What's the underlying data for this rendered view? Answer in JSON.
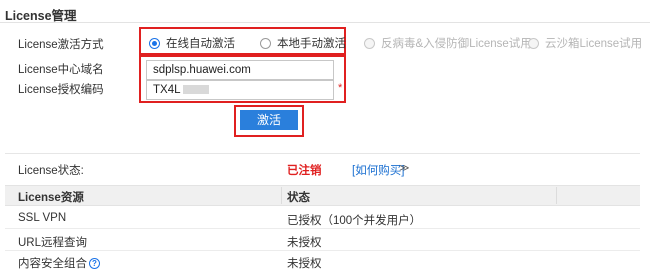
{
  "page": {
    "title": "License管理"
  },
  "form": {
    "activation_mode_label": "License激活方式",
    "modes": [
      {
        "label": "在线自动激活",
        "checked": true,
        "disabled": false
      },
      {
        "label": "本地手动激活",
        "checked": false,
        "disabled": false
      },
      {
        "label": "反病毒&入侵防御License试用",
        "checked": false,
        "disabled": true
      },
      {
        "label": "云沙箱License试用",
        "checked": false,
        "disabled": true
      }
    ],
    "domain_label": "License中心域名",
    "domain_value": "sdplsp.huawei.com",
    "code_label": "License授权编码",
    "code_value": "TX4L",
    "required_mark": "*",
    "activate_button": "激活"
  },
  "status": {
    "label": "License状态:",
    "value": "已注销",
    "how_to_buy": "[如何购买]",
    "chevron": "≫"
  },
  "table": {
    "columns": [
      "License资源",
      "状态"
    ],
    "rows": [
      {
        "resource": "SSL VPN",
        "status": "已授权（100个并发用户）",
        "help": false
      },
      {
        "resource": "URL远程查询",
        "status": "未授权",
        "help": false
      },
      {
        "resource": "内容安全组合",
        "status": "未授权",
        "help": true
      }
    ],
    "help_icon": "?"
  },
  "colors": {
    "accent": "#2a7fdc",
    "highlight_border": "#e02020",
    "status_cancelled": "#e02020",
    "link": "#1a6fd1"
  }
}
